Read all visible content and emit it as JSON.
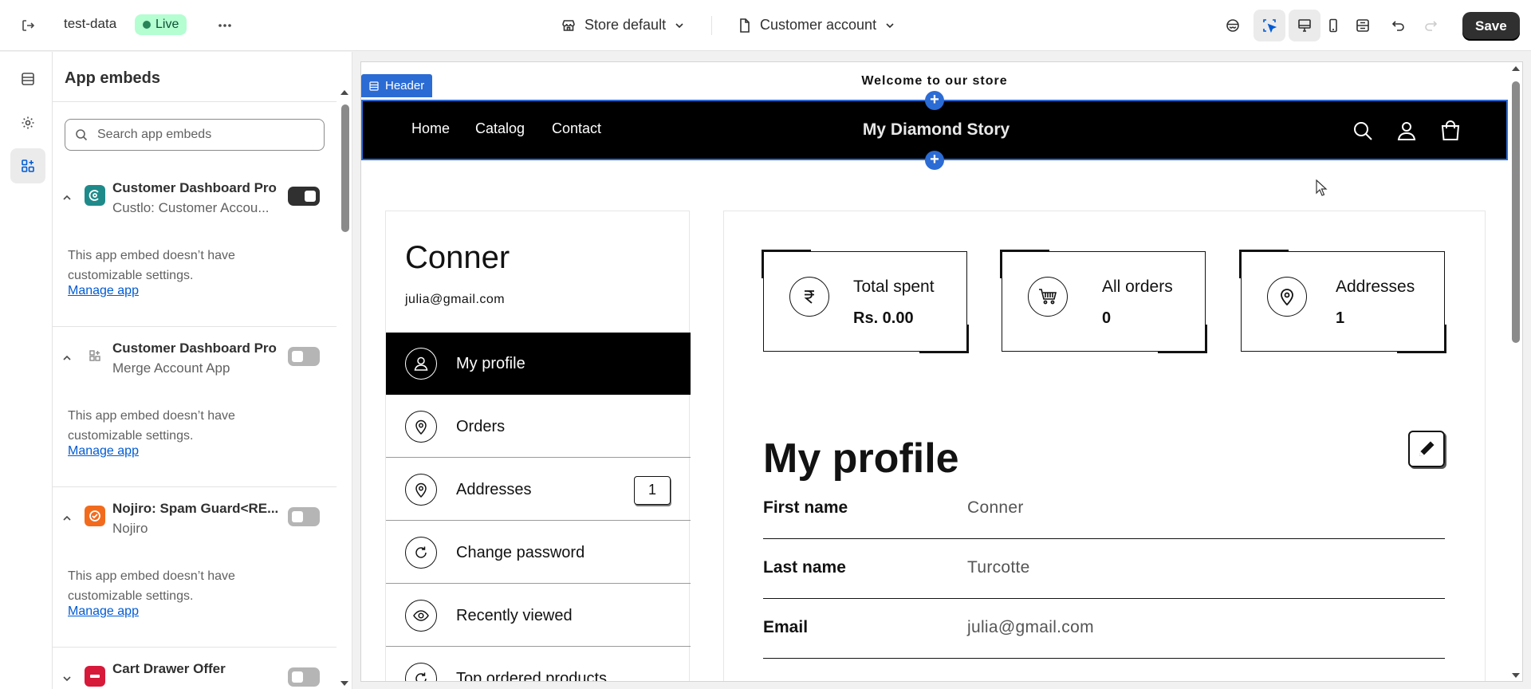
{
  "topbar": {
    "store_name": "test-data",
    "live_label": "Live",
    "theme_select": "Store default",
    "page_select": "Customer account",
    "save_label": "Save"
  },
  "sidebar": {
    "title": "App embeds",
    "search_placeholder": "Search app embeds",
    "embeds": [
      {
        "name": "Customer Dashboard Pro",
        "sub": "Custlo: Customer Accou...",
        "enabled": true,
        "note": "This app embed doesn’t have customizable settings.",
        "link": "Manage app"
      },
      {
        "name": "Customer Dashboard Pro",
        "sub": "Merge Account App",
        "enabled": false,
        "note": "This app embed doesn’t have customizable settings.",
        "link": "Manage app"
      },
      {
        "name": "Nojiro: Spam Guard<RE...",
        "sub": "Nojiro",
        "enabled": false,
        "note": "This app embed doesn’t have customizable settings.",
        "link": "Manage app"
      },
      {
        "name": "Cart Drawer Offer",
        "sub": "",
        "enabled": false
      }
    ]
  },
  "preview": {
    "announcement": "Welcome to our store",
    "section_tag": "Header",
    "nav": [
      "Home",
      "Catalog",
      "Contact"
    ],
    "brand": "My Diamond Story",
    "customer": {
      "name": "Conner",
      "email": "julia@gmail.com"
    },
    "menu": [
      {
        "label": "My profile",
        "icon": "user-icon"
      },
      {
        "label": "Orders",
        "icon": "pin-icon"
      },
      {
        "label": "Addresses",
        "icon": "pin-icon",
        "badge": "1"
      },
      {
        "label": "Change password",
        "icon": "refresh-icon"
      },
      {
        "label": "Recently viewed",
        "icon": "eye-icon"
      },
      {
        "label": "Top ordered products",
        "icon": "refresh-icon"
      }
    ],
    "stats": [
      {
        "label": "Total spent",
        "value": "Rs. 0.00",
        "icon": "rupee-icon"
      },
      {
        "label": "All orders",
        "value": "0",
        "icon": "cart-icon"
      },
      {
        "label": "Addresses",
        "value": "1",
        "icon": "pin-icon"
      }
    ],
    "profile_title": "My profile",
    "fields": [
      {
        "label": "First name",
        "value": "Conner"
      },
      {
        "label": "Last name",
        "value": "Turcotte"
      },
      {
        "label": "Email",
        "value": "julia@gmail.com"
      }
    ]
  }
}
